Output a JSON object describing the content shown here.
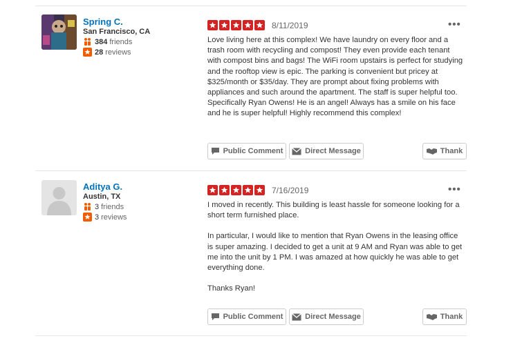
{
  "reviews": [
    {
      "user_name": "Spring C.",
      "location": "San Francisco, CA",
      "friends_count": "384",
      "friends_label": "friends",
      "reviews_count": "28",
      "reviews_label": "reviews",
      "rating": 5,
      "date": "8/11/2019",
      "more_label": "•••",
      "paragraphs": [
        "Love living here at this complex! We have laundry on every floor and a trash room with recycling and compost! They even provide each tenant with compost bins and bags! The WiFi room upstairs is perfect for studying and the rooftop view is epic. The parking is convenient but pricey at $325/month or $35/day. They are prompt about fixing problems with appliances and such around the apartment. The staff is super helpful too. Specifically Ryan Owens! He is an angel! Always has a smile on his face and he is super helpful! Highly recommend this complex!"
      ]
    },
    {
      "user_name": "Aditya G.",
      "location": "Austin, TX",
      "friends_count": "3",
      "friends_label": "friends",
      "reviews_count": "3",
      "reviews_label": "reviews",
      "rating": 5,
      "date": "7/16/2019",
      "more_label": "•••",
      "paragraphs": [
        "I moved in recently. This building is least hassle for someone looking for a short term furnished place.",
        "In particular, I would like to mention that Ryan Owens in the leasing office is super amazing. I decided to get a unit at 9 AM and Ryan was able to get me into the unit by 1 PM. I was amazed at how quickly he was able to get everything done.",
        "Thanks Ryan!"
      ]
    }
  ],
  "actions": {
    "public_comment": "Public Comment",
    "direct_message": "Direct Message",
    "thank": "Thank"
  },
  "colors": {
    "star": "#d32323",
    "link": "#0073bb"
  },
  "icons": [
    "friends-icon",
    "reviews-star-icon",
    "comment-icon",
    "envelope-icon",
    "handshake-icon",
    "star-icon",
    "more-icon"
  ]
}
